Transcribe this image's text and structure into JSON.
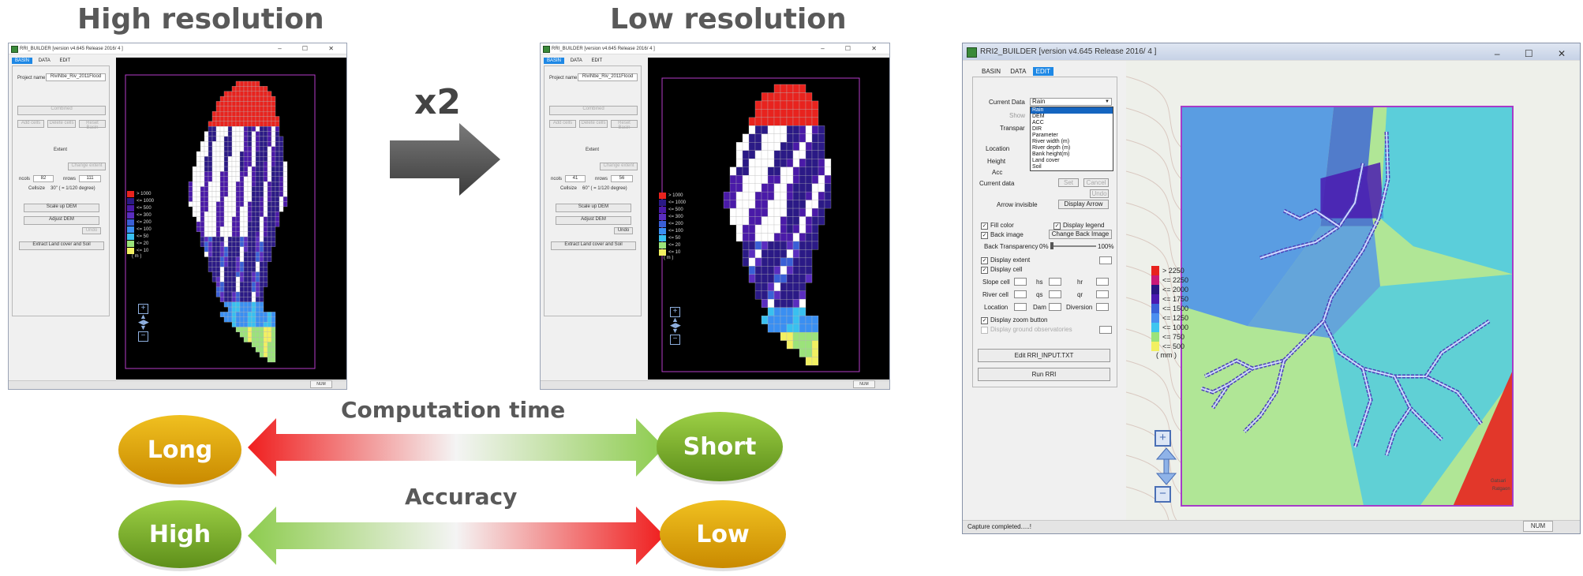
{
  "headings": {
    "high_res": "High resolution",
    "low_res": "Low resolution",
    "scale_factor": "x2"
  },
  "small_window_title": "RRI_BUILDER  [version  v4.645  Release 2016/ 4 ]",
  "small_tabs": [
    "BASIN",
    "DATA",
    "EDIT"
  ],
  "small_panel": {
    "project_label": "Project name",
    "project_value_high": "RiviNbe_Riv_2011Flood",
    "project_value_low": "RiviNbe_Riv_2011Flood",
    "combined_label": "Combined",
    "add_cells": "Add cells",
    "delete_cells": "Delete cells",
    "reset_basin": "Reset Basin",
    "extent_label": "Extent",
    "change_extent": "Change extent",
    "ncols_label": "ncols",
    "nrows_label": "nrows",
    "ncols_high": "82",
    "nrows_high": "111",
    "ncols_low": "41",
    "nrows_low": "56",
    "cellsize_label": "Cellsize",
    "cellsize_high": "30\" ( = 1/120 degree)",
    "cellsize_low": "60\" ( = 1/120 degree)",
    "scale_up": "Scale up DEM",
    "adjust": "Adjust DEM",
    "undo": "Undo",
    "extract": "Extract Land cover and Soil"
  },
  "small_legend": {
    "labels": [
      "> 1000",
      "<= 1000",
      "<= 500",
      "<= 300",
      "<= 200",
      "<= 100",
      "<= 50",
      "<= 20",
      "<= 10"
    ],
    "unit": "( m )",
    "colors": [
      "#e8231e",
      "#2b1a86",
      "#4a1aa8",
      "#5a2dbf",
      "#3a5fd6",
      "#3a8ff2",
      "#39c0f0",
      "#9be37a",
      "#f2f061"
    ]
  },
  "status_num": "NUM",
  "big_window": {
    "title": "RRI2_BUILDER  [version  v4.645  Release 2016/ 4 ]",
    "tabs": [
      "BASIN",
      "DATA",
      "EDIT"
    ],
    "current_data_label": "Current Data",
    "current_data_value": "Rain",
    "dropdown_options": [
      "Rain",
      "DEM",
      "ACC",
      "DIR",
      "Parameter",
      "River width (m)",
      "River depth (m)",
      "Bank height(m)",
      "Land cover",
      "Soil"
    ],
    "show_label": "Show",
    "transparency_label": "Transpar",
    "location_label": "Location",
    "height_label": "Height",
    "acc_label": "Acc",
    "current_data2_label": "Current data",
    "set_btn": "Set",
    "cancel_btn": "Cancel",
    "undo_btn": "Undo",
    "arrow_invisible": "Arrow invisible",
    "display_arrow": "Display Arrow",
    "fill_color": "Fill color",
    "display_legend": "Display legend",
    "back_image": "Back image",
    "change_back_image": "Change Back Image",
    "back_transparency": "Back Transparency",
    "trans_min": "0%",
    "trans_max": "100%",
    "display_extent": "Display extent",
    "display_cell": "Display cell",
    "slope_cell": "Slope cell",
    "hs": "hs",
    "hr": "hr",
    "river_cell": "River cell",
    "qs": "qs",
    "qr": "qr",
    "location2": "Location",
    "dam": "Dam",
    "diversion": "Diversion",
    "display_zoom": "Display zoom button",
    "display_ground": "Display ground observatories",
    "edit_input": "Edit RRI_INPUT.TXT",
    "run_rri": "Run RRI",
    "status_text": "Capture completed.....!",
    "num": "NUM",
    "map_label_1": "Gatsari",
    "map_label_2": "Ratgaon"
  },
  "big_legend": {
    "labels": [
      "> 2250",
      "<= 2250",
      "<= 2000",
      "<= 1750",
      "<= 1500",
      "<= 1250",
      "<= 1000",
      "<= 750",
      "<= 500"
    ],
    "unit": "( mm )",
    "colors": [
      "#e8231e",
      "#c91a78",
      "#2a1682",
      "#4a1ab0",
      "#3a62d8",
      "#4b8ff0",
      "#3fc6f0",
      "#9be37a",
      "#f2f061"
    ]
  },
  "infographic": {
    "row1_caption": "Computation time",
    "row1_left": "Long",
    "row1_right": "Short",
    "row2_caption": "Accuracy",
    "row2_left": "High",
    "row2_right": "Low",
    "colors": {
      "gold": "#d99a00",
      "green": "#6a9a1f",
      "red": "#f01e1e",
      "lightgreen": "#8dcc4e"
    }
  }
}
